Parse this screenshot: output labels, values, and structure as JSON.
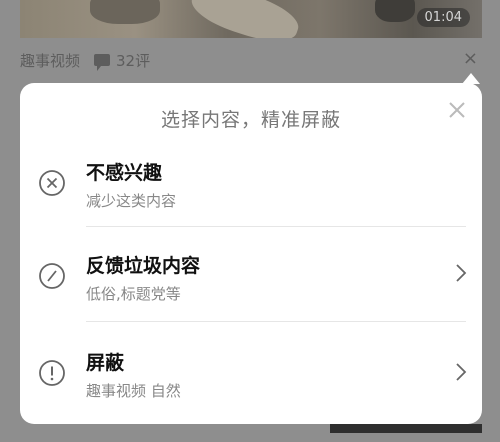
{
  "video": {
    "duration": "01:04"
  },
  "meta": {
    "source": "趣事视频",
    "comments": "32评",
    "close_glyph": "×"
  },
  "popup": {
    "title": "选择内容，精准屏蔽",
    "items": [
      {
        "title": "不感兴趣",
        "subtitle": "减少这类内容",
        "icon": "x-circle-icon",
        "has_chevron": false
      },
      {
        "title": "反馈垃圾内容",
        "subtitle": "低俗,标题党等",
        "icon": "slash-circle-icon",
        "has_chevron": true
      },
      {
        "title": "屏蔽",
        "subtitle": "趣事视频 自然",
        "icon": "exclamation-circle-icon",
        "has_chevron": true
      }
    ]
  },
  "colors": {
    "overlay": "#8e8e8e",
    "card": "#ffffff",
    "title": "#111111",
    "subtitle": "#888888"
  }
}
